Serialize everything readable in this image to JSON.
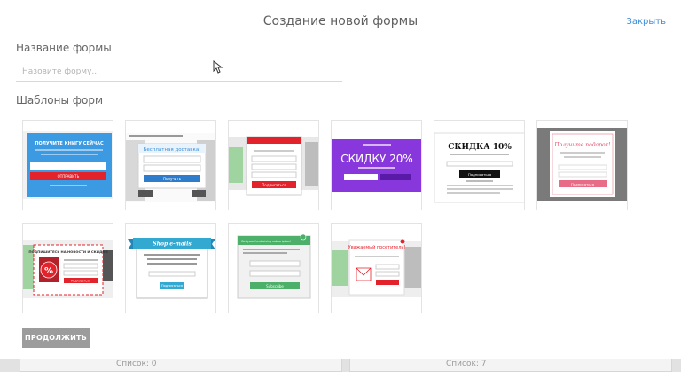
{
  "header": {
    "title": "Создание новой формы",
    "close_label": "Закрыть"
  },
  "form_name": {
    "label": "Название формы",
    "placeholder": "Назовите форму..."
  },
  "templates": {
    "label": "Шаблоны форм",
    "items": [
      {
        "name": "template-1",
        "heading": "ПОЛУЧИТЕ КНИГУ СЕЙЧАС",
        "button": "ОТПРАВИТЬ"
      },
      {
        "name": "template-2",
        "heading": "Бесплатная доставка!",
        "button": "Получить"
      },
      {
        "name": "template-3",
        "button": "Подписаться"
      },
      {
        "name": "template-4",
        "heading": "СКИДКУ 20%"
      },
      {
        "name": "template-5",
        "heading": "СКИДКА 10%",
        "button": "Подписаться"
      },
      {
        "name": "template-6",
        "heading": "Получите подарок!",
        "button": "Подписаться"
      },
      {
        "name": "template-7",
        "heading": "ПОДПИШИТЕСЬ НА НОВОСТИ И СКИДКИ",
        "button": "Подписаться"
      },
      {
        "name": "template-8",
        "heading": "Shop e-mails",
        "button": "Подписаться"
      },
      {
        "name": "template-9",
        "heading": "Get your fundraising subscription!",
        "button": "Subscribe"
      },
      {
        "name": "template-10",
        "heading": "Уважаемый посетитель!"
      }
    ]
  },
  "actions": {
    "continue_label": "ПРОДОЛЖИТЬ"
  },
  "background": {
    "left_label": "Список: 0",
    "right_label": "Список: 7"
  },
  "colors": {
    "accent": "#3b8ed8",
    "button_bg": "#9c9c9c",
    "red": "#e3232b",
    "purple": "#7c2fd6",
    "green": "#4caf6a",
    "teal": "#33a9d2"
  }
}
